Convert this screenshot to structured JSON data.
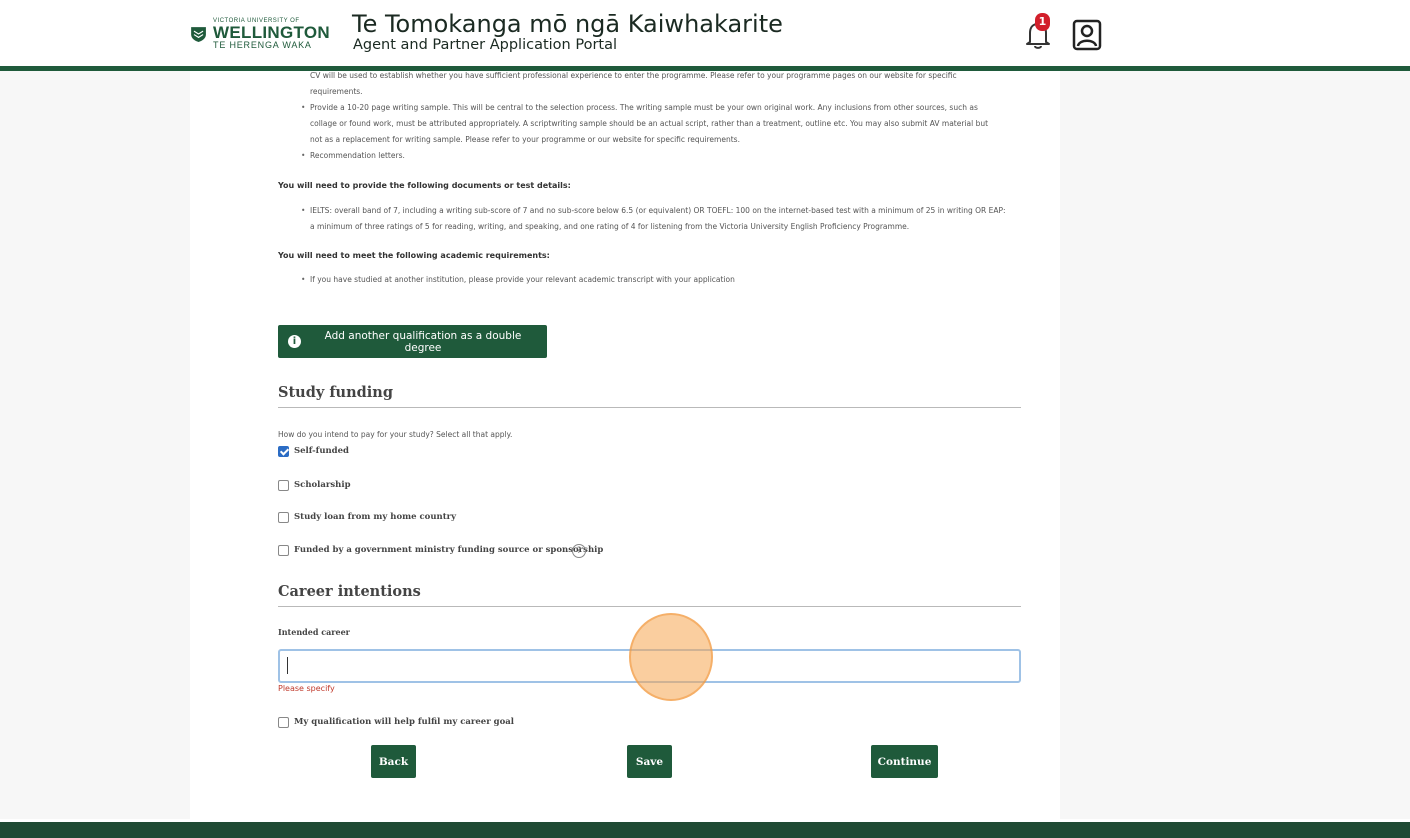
{
  "header": {
    "logo": {
      "top": "VICTORIA UNIVERSITY OF",
      "main": "WELLINGTON",
      "bottom": "TE HERENGA WAKA"
    },
    "title": "Te Tomokanga mō ngā Kaiwhakarite",
    "subtitle": "Agent and Partner Application Portal",
    "notification_count": "1",
    "icons": [
      "bell-icon",
      "user-icon"
    ]
  },
  "requirements": {
    "cv_text_line1": "CV will be used to establish whether you have sufficient professional experience to enter the programme. Please refer to your programme pages on our website for specific",
    "cv_text_line2": "requirements.",
    "writing_sample_line1": "Provide a 10-20 page writing sample. This will be central to the selection process. The writing sample must be your own original work. Any inclusions from other sources, such as",
    "writing_sample_line2": "collage or found work, must be attributed appropriately. A scriptwriting sample should be an actual script, rather than a treatment, outline etc. You may also submit AV material but",
    "writing_sample_line3": "not as a replacement for writing sample. Please refer to your programme or our website for specific requirements.",
    "recommendation": "Recommendation letters.",
    "documents_heading": "You will need to provide the following documents or test details:",
    "ielts_line1": "IELTS: overall band of 7, including a writing sub-score of 7 and no sub-score below 6.5 (or equivalent) OR TOEFL: 100 on the internet-based test with a minimum of 25 in writing OR EAP:",
    "ielts_line2": "a minimum of three ratings of 5 for reading, writing, and speaking, and one rating of 4 for listening from the Victoria University English Proficiency Programme.",
    "academic_heading": "You will need to meet the following academic requirements:",
    "academic_item": "If you have studied at another institution, please provide your relevant academic transcript with your application"
  },
  "double_degree_button": "Add another qualification as a double degree",
  "study_funding": {
    "title": "Study funding",
    "question": "How do you intend to pay for your study? Select all that apply.",
    "options": [
      {
        "label": "Self-funded",
        "checked": true
      },
      {
        "label": "Scholarship",
        "checked": false
      },
      {
        "label": "Study loan from my home country",
        "checked": false
      },
      {
        "label": "Funded by a government ministry funding source or sponsorship",
        "checked": false
      }
    ],
    "help_glyph": "?"
  },
  "career": {
    "title": "Career intentions",
    "field_label": "Intended career",
    "field_value": "",
    "error": "Please specify",
    "goal_checkbox": "My qualification will help fulfil my career goal"
  },
  "actions": {
    "back": "Back",
    "save": "Save",
    "continue": "Continue"
  },
  "colors": {
    "brand_green": "#1f5a3b",
    "checkbox_blue": "#2b6cc4",
    "error_red": "#c0392b",
    "badge_red": "#d21f2b"
  }
}
